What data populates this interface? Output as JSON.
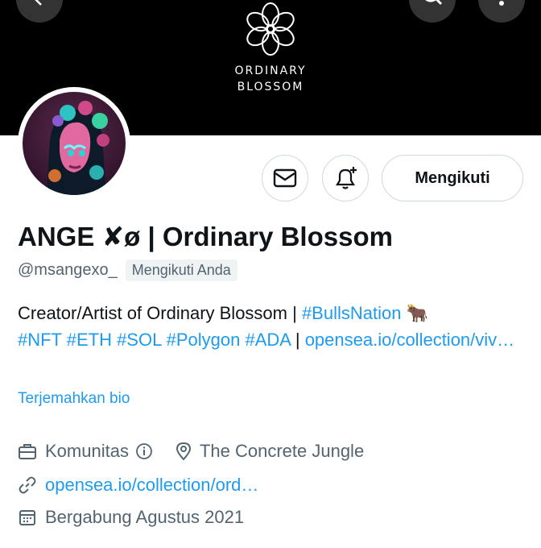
{
  "header": {
    "brand_line1": "ORDINARY",
    "brand_line2": "BLOSSOM"
  },
  "actions": {
    "follow_label": "Mengikuti"
  },
  "profile": {
    "name": "ANGE ✘ø | Ordinary Blossom",
    "handle": "@msangexo_",
    "follows_you": "Mengikuti Anda",
    "bio_text": "Creator/Artist of Ordinary Blossom | ",
    "bio_tag1": "#BullsNation",
    "bio_emoji": "🐂",
    "bio_tags2": "#NFT #ETH #SOL #Polygon #ADA",
    "bio_sep": " | ",
    "bio_link": "opensea.io/collection/viv…",
    "translate_label": "Terjemahkan bio",
    "category": "Komunitas",
    "location": "The Concrete Jungle",
    "website": "opensea.io/collection/ord…",
    "joined": "Bergabung Agustus 2021"
  },
  "colors": {
    "accent": "#1d9bf0",
    "secondary_text": "#536471",
    "banner": "#000000"
  },
  "icons": [
    "back-arrow-icon",
    "search-icon",
    "more-vertical-icon",
    "flower-logo-icon",
    "mail-icon",
    "bell-plus-icon",
    "briefcase-icon",
    "info-icon",
    "location-pin-icon",
    "link-icon",
    "calendar-icon"
  ]
}
